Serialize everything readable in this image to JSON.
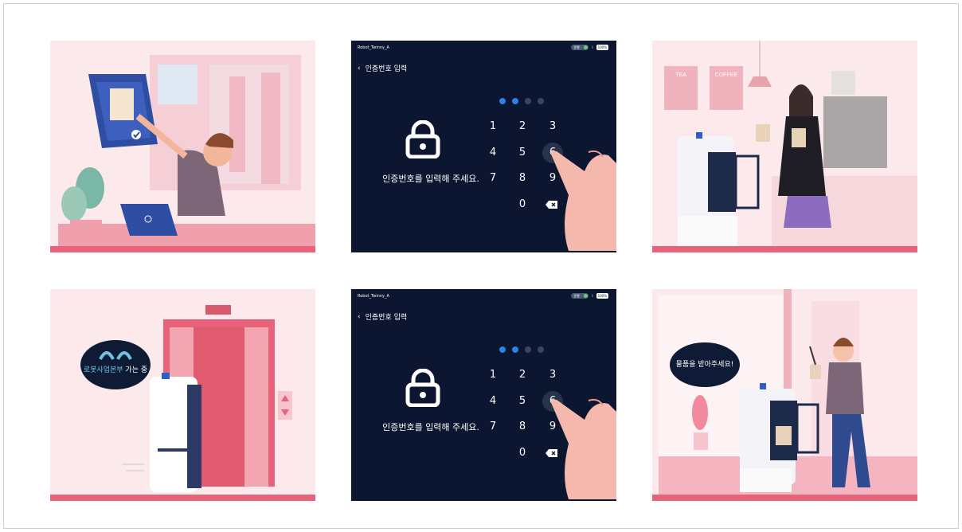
{
  "screens": [
    {
      "robot_name": "Robot_Twinny_A",
      "status_label": "운행",
      "separator": "I",
      "battery": "100%",
      "back_icon": "chevron-left-icon",
      "title": "인증번호 입력",
      "lock_icon": "lock-icon",
      "prompt": "인증번호를 입력해 주세요.",
      "entered_count": 2,
      "keys": [
        "1",
        "2",
        "3",
        "4",
        "5",
        "6",
        "7",
        "8",
        "9",
        "0"
      ],
      "delete_icon": "backspace-icon",
      "highlighted_key": "6"
    },
    {
      "robot_name": "Robot_Twinny_A",
      "status_label": "운행",
      "separator": "I",
      "battery": "100%",
      "back_icon": "chevron-left-icon",
      "title": "인증번호 입력",
      "lock_icon": "lock-icon",
      "prompt": "인증번호를 입력해 주세요.",
      "entered_count": 2,
      "keys": [
        "1",
        "2",
        "3",
        "4",
        "5",
        "6",
        "7",
        "8",
        "9",
        "0"
      ],
      "delete_icon": "backspace-icon",
      "highlighted_key": "6"
    }
  ],
  "illustrations": {
    "order": {},
    "cafe": {
      "menu_left": "TEA",
      "menu_right": "COFFEE"
    },
    "elevator": {
      "bubble_line1_highlight": "로봇사업본부",
      "bubble_line1_rest": " 가는 중"
    },
    "delivery": {
      "bubble_text": "물품을 받아주세요!"
    }
  },
  "colors": {
    "accent_pink": "#e8637a",
    "screen_bg": "#0c1631",
    "dot_active": "#2f7fe6",
    "bubble_highlight": "#6fc3e0"
  }
}
